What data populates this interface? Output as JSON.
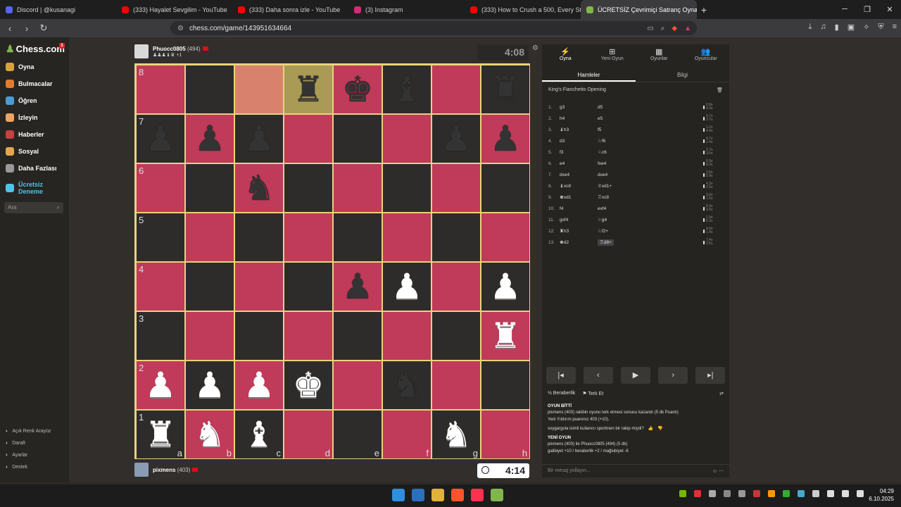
{
  "browser": {
    "tabs": [
      {
        "label": "Discord | @kusanagi",
        "color": "#5865f2"
      },
      {
        "label": "(333) Hayalet Sevgilim - YouTube",
        "color": "#ff0000"
      },
      {
        "label": "(333) Daha sonra izle - YouTube",
        "color": "#ff0000"
      },
      {
        "label": "(3) Instagram",
        "color": "#d62976"
      },
      {
        "label": "(333) How to Crush a 500, Every Step",
        "color": "#ff0000"
      },
      {
        "label": "ÜCRETSİZ Çevrimiçi Satranç Oyna",
        "color": "#81b64c"
      }
    ],
    "url": "chess.com/game/143951634664"
  },
  "sidebar": {
    "logo": "Chess.com",
    "badge": "1",
    "items": [
      {
        "label": "Oyna",
        "color": "#d9a23f"
      },
      {
        "label": "Bulmacalar",
        "color": "#e07b33"
      },
      {
        "label": "Öğren",
        "color": "#4b9cd3"
      },
      {
        "label": "İzleyin",
        "color": "#f0a35e"
      },
      {
        "label": "Haberler",
        "color": "#c94040"
      },
      {
        "label": "Sosyal",
        "color": "#e3a84f"
      },
      {
        "label": "Daha Fazlası",
        "color": "#999999"
      },
      {
        "label": "Ücretsiz Deneme",
        "color": "#4fc3e8"
      }
    ],
    "search_placeholder": "Ara",
    "bottom": [
      "Açık Renk Arayüz",
      "Daralt",
      "Ayarlar",
      "Destek"
    ]
  },
  "top_player": {
    "name": "Phuocc0805",
    "rating": "(494)",
    "captured": "+1"
  },
  "bottom_player": {
    "name": "pixmens",
    "rating": "(403)"
  },
  "top_clock": "4:08",
  "bottom_clock": "4:14",
  "board": {
    "ranks": [
      "8",
      "7",
      "6",
      "5",
      "4",
      "3",
      "2",
      "1"
    ],
    "files": [
      "a",
      "b",
      "c",
      "d",
      "e",
      "f",
      "g",
      "h"
    ],
    "position": [
      [
        "",
        "",
        "",
        "br",
        "bk",
        "bb",
        "",
        "br"
      ],
      [
        "bp",
        "bp",
        "bp",
        "",
        "",
        "",
        "bp",
        "bp"
      ],
      [
        "",
        "",
        "bn",
        "",
        "",
        "",
        "",
        ""
      ],
      [
        "",
        "",
        "",
        "",
        "",
        "",
        "",
        ""
      ],
      [
        "",
        "",
        "",
        "",
        "bp",
        "wp",
        "",
        "wp"
      ],
      [
        "",
        "",
        "",
        "",
        "",
        "",
        "",
        "wr"
      ],
      [
        "wp",
        "wp",
        "wp",
        "wk",
        "",
        "bn",
        "",
        ""
      ],
      [
        "wr",
        "wn",
        "wb",
        "",
        "",
        "",
        "wn",
        ""
      ]
    ],
    "highlight_orange": "c8",
    "highlight_yellow": "d8"
  },
  "panel": {
    "tabs": [
      "Oyna",
      "Yeni Oyun",
      "Oyunlar",
      "Oyuncular"
    ],
    "subtabs": [
      "Hamleler",
      "Bilgi"
    ],
    "opening": "King's Fianchetto Opening",
    "moves": [
      {
        "n": "1.",
        "w": "g3",
        "b": "d5",
        "tw": "0.9s",
        "tb": "4.3s"
      },
      {
        "n": "2.",
        "w": "h4",
        "b": "e5",
        "tw": "0.7s",
        "tb": "3.7s"
      },
      {
        "n": "3.",
        "w": "♝h3",
        "b": "f5",
        "tw": "1.2s",
        "tb": "4.4s"
      },
      {
        "n": "4.",
        "w": "d3",
        "b": "♘f6",
        "tw": "4.7s",
        "tb": "1.4s"
      },
      {
        "n": "5.",
        "w": "f3",
        "b": "♘c6",
        "tw": "2.7s",
        "tb": "3.0s"
      },
      {
        "n": "6.",
        "w": "e4",
        "b": "fxe4",
        "tw": "0.9s",
        "tb": "8.3s"
      },
      {
        "n": "7.",
        "w": "dxe4",
        "b": "dxe4",
        "tw": "2.8s",
        "tb": "5.9s"
      },
      {
        "n": "8.",
        "w": "♝xc8",
        "b": "♕xd1+",
        "tw": "4.3s",
        "tb": "2.5s"
      },
      {
        "n": "9.",
        "w": "♚xd1",
        "b": "♖xc8",
        "tw": "3.0s",
        "tb": "1.5s"
      },
      {
        "n": "10.",
        "w": "f4",
        "b": "exf4",
        "tw": "6.3s",
        "tb": "3.5s"
      },
      {
        "n": "11.",
        "w": "gxf4",
        "b": "♘g4",
        "tw": "1.9s",
        "tb": "6.3s"
      },
      {
        "n": "12.",
        "w": "♜h3",
        "b": "♘f2+",
        "tw": "4.9s",
        "tb": "1.4s"
      },
      {
        "n": "13.",
        "w": "♚d2",
        "b": "♖d8+",
        "tw": "7.4s",
        "tb": "3.5s"
      }
    ],
    "draw": "Beraberlik",
    "resign": "Terk Et",
    "chat": {
      "header": "OYUN BİTTİ",
      "line1": "pixmens (403) rakibin oyunu terk etmesi sonucu kazandı (5 dk Puanlı)",
      "line2": "Yeni Yıldırım puanınız 403 (+10).",
      "line3": "soygargola isimli kullanıcı sportmen bir rakip miydi?",
      "new_game": "YENİ OYUN",
      "line4": "pixmens (403) ile Phuocc0805 (494) (5 dk)",
      "line5": "galibiyet +10 / beraberlik +2 / mağlubiyet -6"
    },
    "chat_placeholder": "Bir mesaj yollayın..."
  },
  "taskbar": {
    "time": "04:29",
    "date": "6.10.2025"
  },
  "pieces": {
    "wk": "♚",
    "wq": "♛",
    "wr": "♜",
    "wb": "♝",
    "wn": "♞",
    "wp": "♟",
    "bk": "♚",
    "bq": "♛",
    "br": "♜",
    "bb": "♝",
    "bn": "♞",
    "bp": "♟"
  }
}
